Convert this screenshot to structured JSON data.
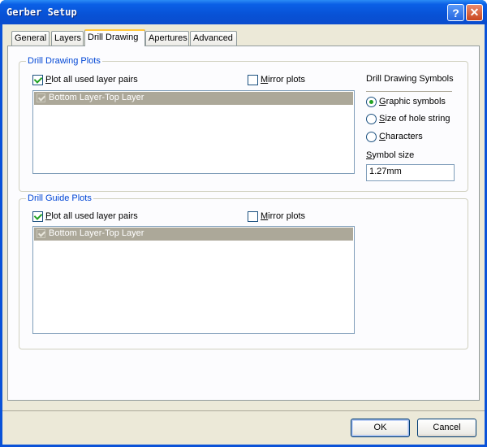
{
  "window": {
    "title": "Gerber Setup",
    "help_glyph": "?",
    "close_glyph": "✕"
  },
  "tabs": [
    {
      "label": "General"
    },
    {
      "label": "Layers"
    },
    {
      "label": "Drill Drawing"
    },
    {
      "label": "Apertures"
    },
    {
      "label": "Advanced"
    }
  ],
  "active_tab": "Drill Drawing",
  "drill_drawing_plots": {
    "title": "Drill Drawing Plots",
    "plot_all_label_prefix": "P",
    "plot_all_label_rest": "lot all used layer pairs",
    "plot_all_checked": true,
    "mirror_label_prefix": "M",
    "mirror_label_rest": "irror plots",
    "mirror_checked": false,
    "layer_pairs": [
      {
        "label": "Bottom Layer-Top Layer",
        "checked": true
      }
    ]
  },
  "drill_drawing_symbols": {
    "title": "Drill Drawing Symbols",
    "options": [
      {
        "prefix": "G",
        "rest": "raphic symbols",
        "selected": true
      },
      {
        "prefix": "S",
        "rest": "ize of hole string",
        "selected": false
      },
      {
        "prefix": "C",
        "rest": "haracters",
        "selected": false
      }
    ],
    "symbol_size_label_prefix": "S",
    "symbol_size_label_rest": "ymbol size",
    "symbol_size_value": "1.27mm"
  },
  "drill_guide_plots": {
    "title": "Drill Guide Plots",
    "plot_all_label_prefix": "P",
    "plot_all_label_rest": "lot all used layer pairs",
    "plot_all_checked": true,
    "mirror_label_prefix": "M",
    "mirror_label_rest": "irror plots",
    "mirror_checked": false,
    "layer_pairs": [
      {
        "label": "Bottom Layer-Top Layer",
        "checked": true
      }
    ]
  },
  "buttons": {
    "ok": "OK",
    "cancel": "Cancel"
  },
  "colors": {
    "title_bar": "#0a52d8",
    "group_title": "#0046d5",
    "dialog_face": "#ece9d8",
    "selected_row": "#aca899",
    "check_mark": "#21a121"
  }
}
